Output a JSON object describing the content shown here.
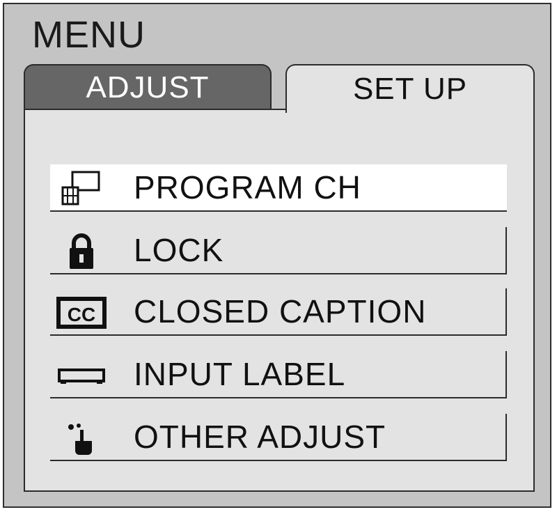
{
  "menu": {
    "title": "MENU",
    "tabs": [
      {
        "label": "ADJUST",
        "active": false
      },
      {
        "label": "SET UP",
        "active": true
      }
    ],
    "items": [
      {
        "label": "PROGRAM CH",
        "icon": "program-channel-icon",
        "selected": true
      },
      {
        "label": "LOCK",
        "icon": "lock-icon",
        "selected": false
      },
      {
        "label": "CLOSED CAPTION",
        "icon": "closed-caption-icon",
        "selected": false
      },
      {
        "label": "INPUT LABEL",
        "icon": "input-label-icon",
        "selected": false
      },
      {
        "label": "OTHER ADJUST",
        "icon": "other-adjust-icon",
        "selected": false
      }
    ]
  },
  "colors": {
    "frame_bg": "#c4c4c4",
    "panel_bg": "#e3e3e3",
    "inactive_tab_bg": "#666666",
    "selected_item_bg": "#ffffff"
  }
}
